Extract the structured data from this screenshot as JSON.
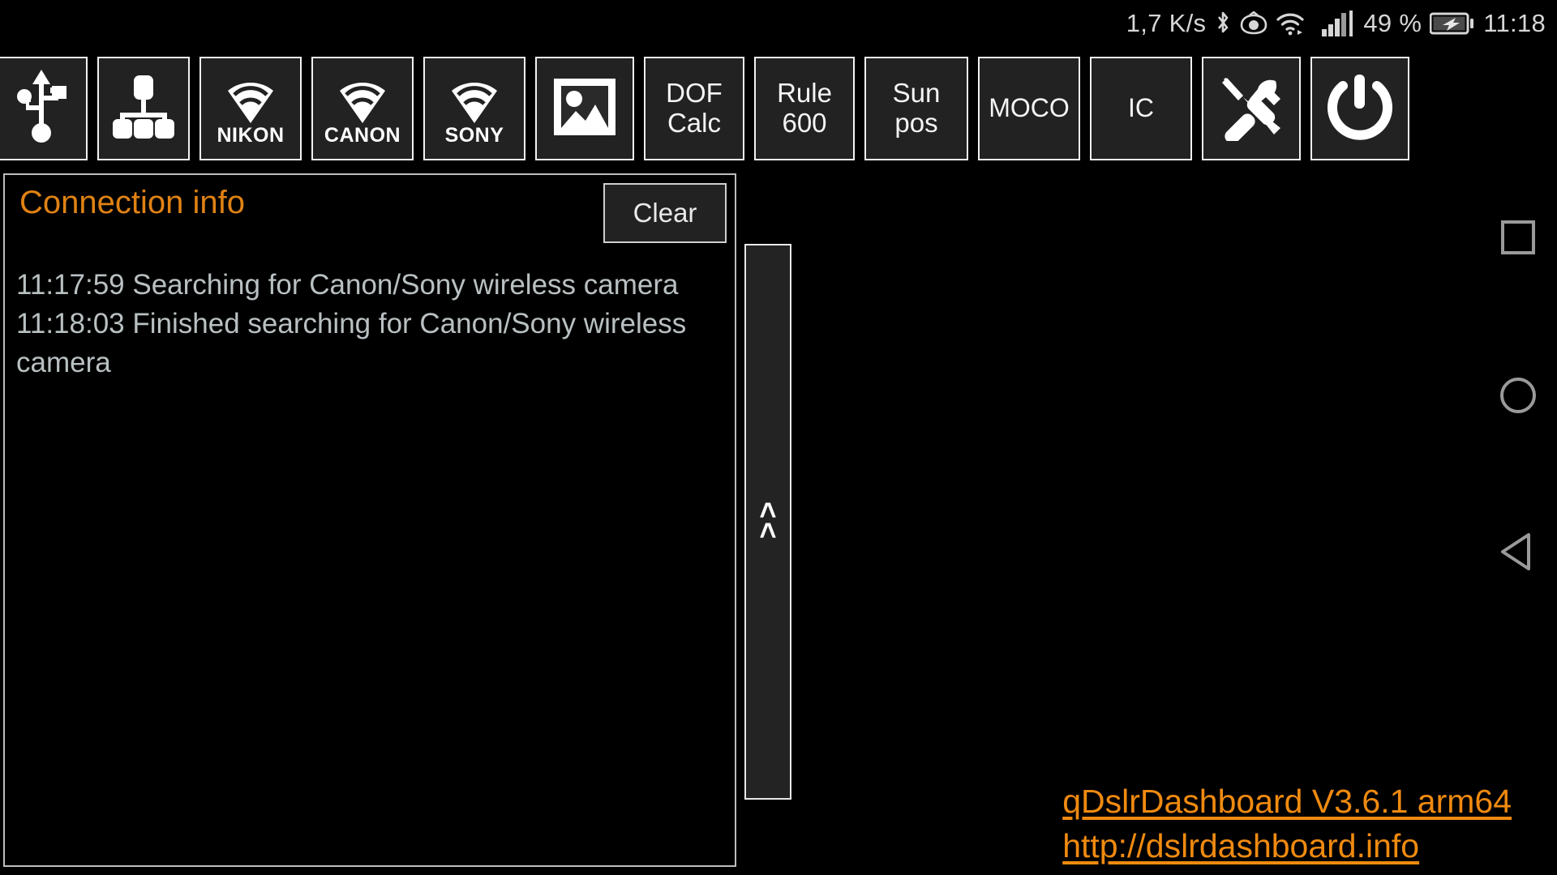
{
  "status_bar": {
    "network_speed": "1,7 K/s",
    "icons": [
      "bluetooth-icon",
      "eye-icon",
      "wifi-icon",
      "signal-bars-icon"
    ],
    "battery_percent": "49 %",
    "battery_state_icon": "battery-charging-icon",
    "clock": "11:18"
  },
  "toolbar": {
    "buttons": [
      {
        "name": "usb-connect",
        "type": "icon",
        "icon": "usb-icon",
        "label": ""
      },
      {
        "name": "network-connect",
        "type": "icon",
        "icon": "network-hub-icon",
        "label": ""
      },
      {
        "name": "nikon-wifi-connect",
        "type": "brand",
        "icon": "wifi-icon",
        "label": "NIKON"
      },
      {
        "name": "canon-wifi-connect",
        "type": "brand",
        "icon": "wifi-icon",
        "label": "CANON"
      },
      {
        "name": "sony-wifi-connect",
        "type": "brand",
        "icon": "wifi-icon",
        "label": "SONY"
      },
      {
        "name": "gallery",
        "type": "icon",
        "icon": "image-icon",
        "label": ""
      },
      {
        "name": "dof-calc",
        "type": "text",
        "icon": "",
        "label": "DOF\nCalc"
      },
      {
        "name": "rule-600",
        "type": "text",
        "icon": "",
        "label": "Rule\n600"
      },
      {
        "name": "sun-pos",
        "type": "text",
        "icon": "",
        "label": "Sun\npos"
      },
      {
        "name": "moco",
        "type": "text",
        "icon": "",
        "label": "MOCO"
      },
      {
        "name": "ic",
        "type": "text",
        "icon": "",
        "label": "IC"
      },
      {
        "name": "settings-tools",
        "type": "icon",
        "icon": "tools-icon",
        "label": ""
      },
      {
        "name": "power",
        "type": "icon",
        "icon": "power-icon",
        "label": ""
      }
    ]
  },
  "connection_panel": {
    "title": "Connection info",
    "clear_label": "Clear",
    "log_lines": [
      "11:17:59  Searching for Canon/Sony wireless camera",
      "11:18:03  Finished searching for Canon/Sony wireless camera"
    ]
  },
  "splitter": {
    "glyph": "<<"
  },
  "footer": {
    "app_version": "qDslrDashboard V3.6.1 arm64",
    "website": "http://dslrdashboard.info"
  },
  "android_nav": {
    "recents": "recents-square-icon",
    "home": "home-circle-icon",
    "back": "back-triangle-icon"
  },
  "colors": {
    "accent_orange": "#e08214",
    "link_orange": "#f08a10",
    "button_face": "#222222",
    "button_border": "#f2f2f2",
    "log_text": "#b9c0c2",
    "background": "#000000"
  }
}
